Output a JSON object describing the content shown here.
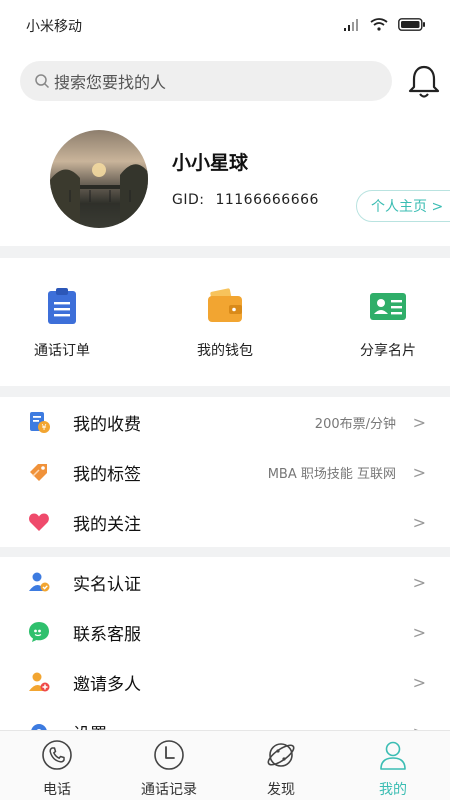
{
  "status_bar": {
    "carrier": "小米移动"
  },
  "search": {
    "placeholder": "搜索您要找的人"
  },
  "profile": {
    "nickname": "小小星球",
    "gid_label": "GID:",
    "gid_value": "11166666666",
    "home_button": "个人主页 >"
  },
  "quick_actions": [
    {
      "label": "通话订单",
      "icon": "clipboard-icon",
      "color": "#3d6fd9"
    },
    {
      "label": "我的钱包",
      "icon": "wallet-icon",
      "color": "#f2a531"
    },
    {
      "label": "分享名片",
      "icon": "business-card-icon",
      "color": "#2fae69"
    }
  ],
  "menu_group_1": [
    {
      "label": "我的收费",
      "value": "200布票/分钟",
      "icon": "fee-icon"
    },
    {
      "label": "我的标签",
      "value": "MBA 职场技能 互联网",
      "icon": "tag-icon"
    },
    {
      "label": "我的关注",
      "value": "",
      "icon": "heart-icon"
    }
  ],
  "menu_group_2": [
    {
      "label": "实名认证",
      "icon": "verified-user-icon"
    },
    {
      "label": "联系客服",
      "icon": "customer-service-icon"
    },
    {
      "label": "邀请多人",
      "icon": "invite-user-icon"
    },
    {
      "label": "设置",
      "icon": "settings-icon"
    }
  ],
  "chevron": ">",
  "tabbar": [
    {
      "label": "电话",
      "icon": "phone-icon",
      "active": false
    },
    {
      "label": "通话记录",
      "icon": "call-history-icon",
      "active": false
    },
    {
      "label": "发现",
      "icon": "planet-icon",
      "active": false
    },
    {
      "label": "我的",
      "icon": "person-icon",
      "active": true
    }
  ],
  "colors": {
    "accent": "#3bbdb3",
    "background": "#f1f2f3"
  }
}
